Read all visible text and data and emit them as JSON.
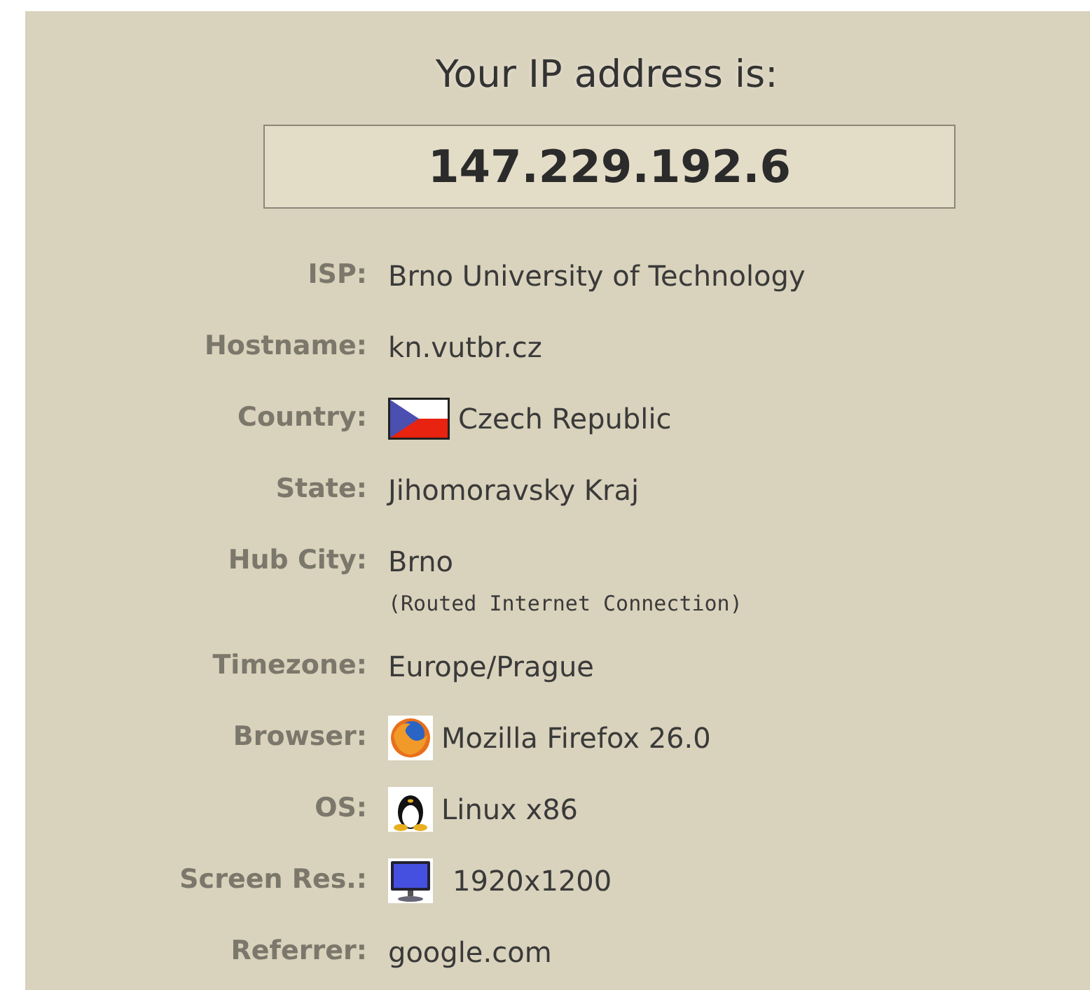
{
  "heading": "Your IP address is:",
  "ip_address": "147.229.192.6",
  "details": [
    {
      "kind": "text",
      "label": "ISP:",
      "value": "Brno University of Technology"
    },
    {
      "kind": "text",
      "label": "Hostname:",
      "value": "kn.vutbr.cz"
    },
    {
      "kind": "flag",
      "label": "Country:",
      "value": "Czech Republic"
    },
    {
      "kind": "text",
      "label": "State:",
      "value": "Jihomoravsky Kraj"
    },
    {
      "kind": "text",
      "label": "Hub City:",
      "value": "Brno",
      "note": "(Routed Internet Connection)"
    },
    {
      "kind": "text",
      "label": "Timezone:",
      "value": "Europe/Prague"
    },
    {
      "kind": "browser",
      "label": "Browser:",
      "value": "Mozilla Firefox 26.0"
    },
    {
      "kind": "os",
      "label": "OS:",
      "value": "Linux x86"
    },
    {
      "kind": "screen",
      "label": "Screen Res.:",
      "value": "1920x1200"
    },
    {
      "kind": "text",
      "label": "Referrer:",
      "value": "google.com"
    }
  ]
}
